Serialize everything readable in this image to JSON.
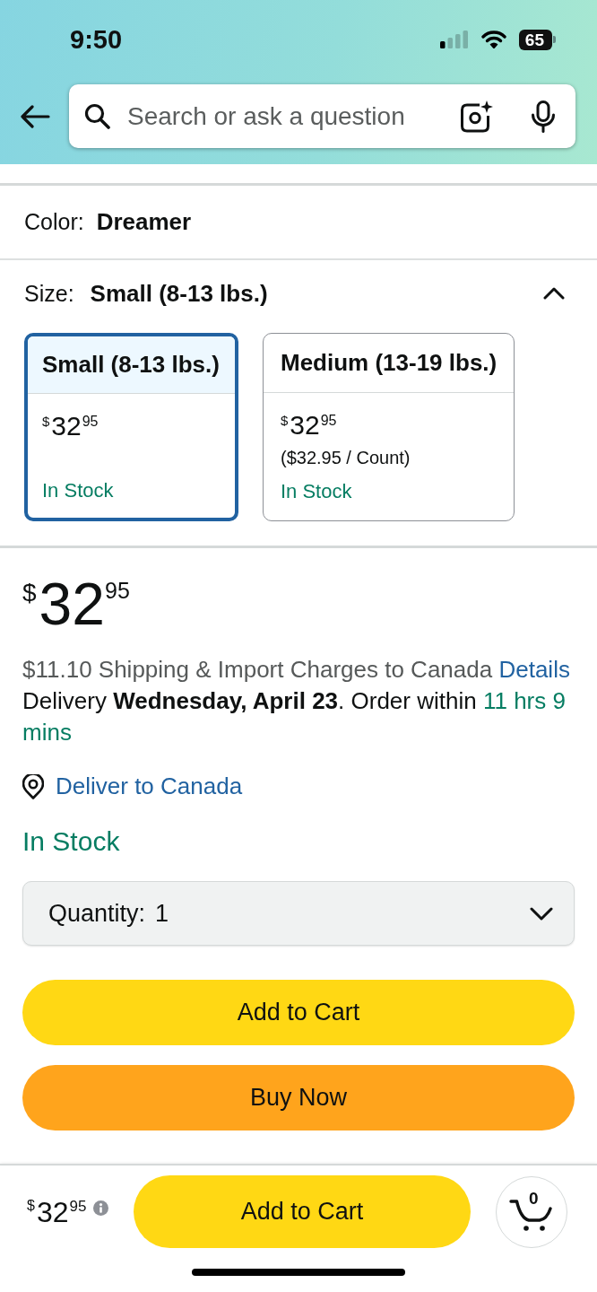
{
  "status_bar": {
    "time": "9:50",
    "battery": "65"
  },
  "search": {
    "placeholder": "Search or ask a question"
  },
  "color": {
    "label": "Color:",
    "value": "Dreamer"
  },
  "size": {
    "label": "Size:",
    "value": "Small (8-13 lbs.)",
    "expanded": true,
    "options": [
      {
        "name": "Small (8-13 lbs.)",
        "price": {
          "symbol": "$",
          "whole": "32",
          "fraction": "95"
        },
        "availability": "In Stock",
        "selected": true
      },
      {
        "name": "Medium (13-19 lbs.)",
        "price": {
          "symbol": "$",
          "whole": "32",
          "fraction": "95"
        },
        "unit_price": "($32.95 / Count)",
        "availability": "In Stock",
        "selected": false
      }
    ]
  },
  "price": {
    "symbol": "$",
    "whole": "32",
    "fraction": "95"
  },
  "shipping": {
    "text": "$11.10 Shipping & Import Charges to Canada",
    "link": "Details"
  },
  "delivery": {
    "text": "Delivery **Wednesday, April 23**. Order within",
    "countdown": "11 hrs 9 mins"
  },
  "deliver_to": {
    "link": "Deliver to Canada"
  },
  "availability": "In Stock",
  "quantity": {
    "label": "Quantity:",
    "value": "1"
  },
  "buttons": [
    {
      "label": "Add to Cart",
      "kind": "cart"
    },
    {
      "label": "Buy Now",
      "kind": "buy"
    }
  ],
  "bottom_bar": {
    "price": {
      "symbol": "$",
      "whole": "32",
      "fraction": "95"
    },
    "button": "Add to Cart",
    "cart_count": "0"
  }
}
